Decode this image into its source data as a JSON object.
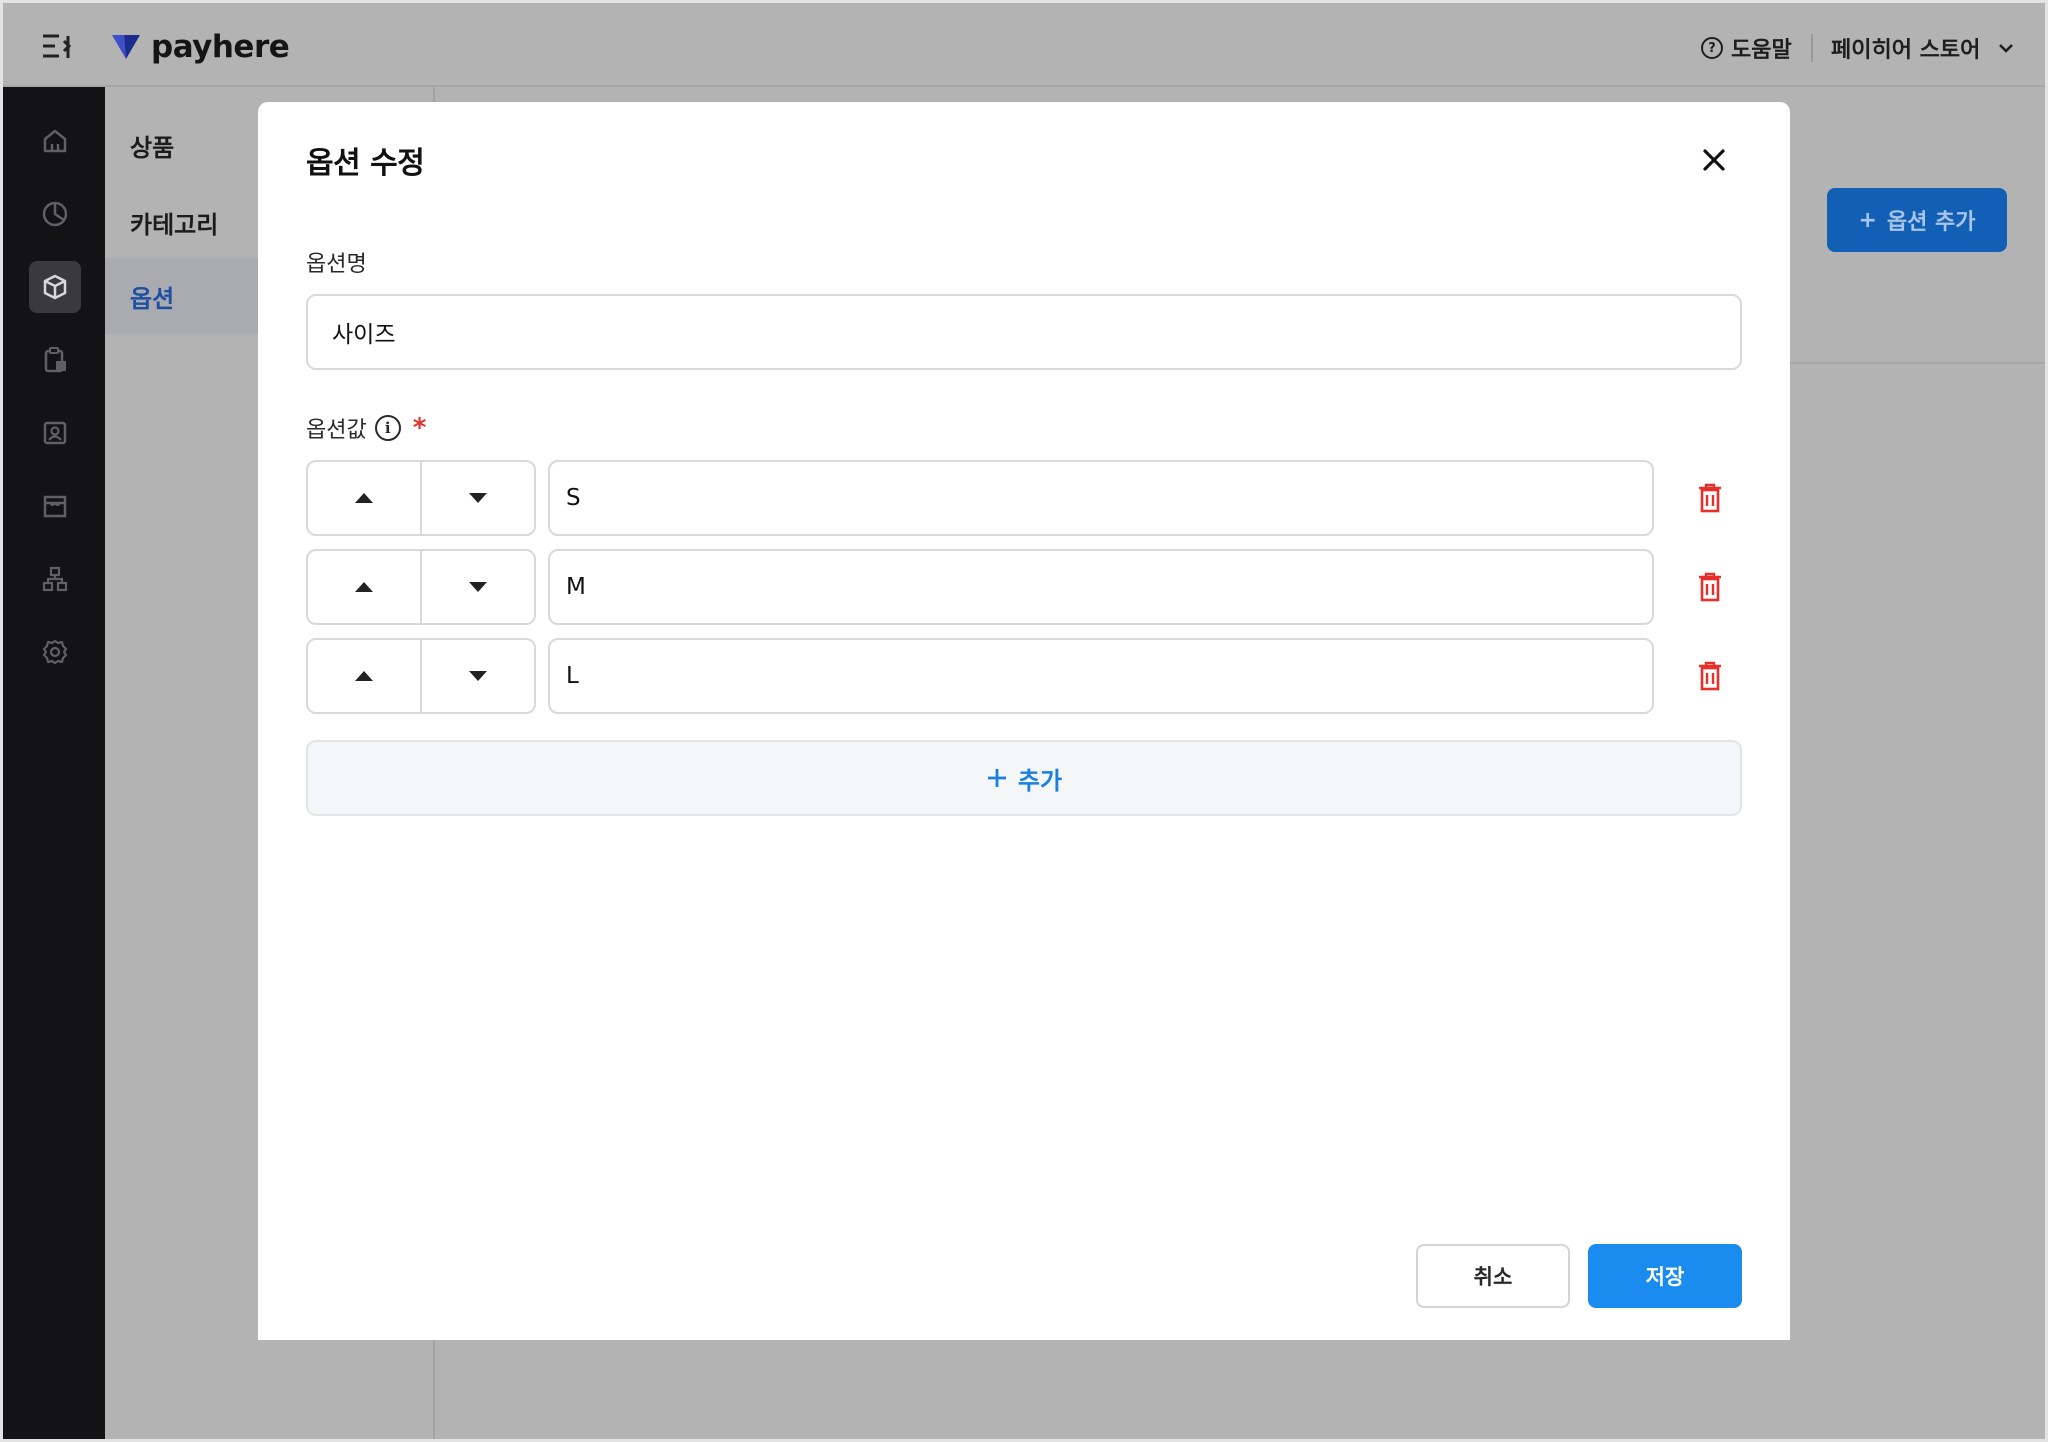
{
  "header": {
    "brand": "payhere",
    "help_label": "도움말",
    "help_icon_glyph": "?",
    "store_name": "페이히어 스토어"
  },
  "rail": {
    "items": [
      {
        "icon": "home-icon"
      },
      {
        "icon": "chart-pie-icon"
      },
      {
        "icon": "box-icon",
        "active": true
      },
      {
        "icon": "clipboard-icon"
      },
      {
        "icon": "contact-card-icon"
      },
      {
        "icon": "store-icon"
      },
      {
        "icon": "org-chart-icon"
      },
      {
        "icon": "gear-icon"
      }
    ]
  },
  "subnav": {
    "items": [
      {
        "label": "상품"
      },
      {
        "label": "카테고리"
      },
      {
        "label": "옵션",
        "active": true
      }
    ]
  },
  "background": {
    "add_option_label": "옵션 추가"
  },
  "modal": {
    "title": "옵션 수정",
    "option_name_label": "옵션명",
    "option_name_value": "사이즈",
    "option_values_label": "옵션값",
    "info_glyph": "i",
    "required_mark": "*",
    "values": [
      "S",
      "M",
      "L"
    ],
    "add_label": "추가",
    "cancel_label": "취소",
    "save_label": "저장"
  },
  "colors": {
    "primary": "#1a8cf0",
    "danger": "#e5302b",
    "rail_bg": "#131316",
    "overlay": "#b3b3b3"
  }
}
